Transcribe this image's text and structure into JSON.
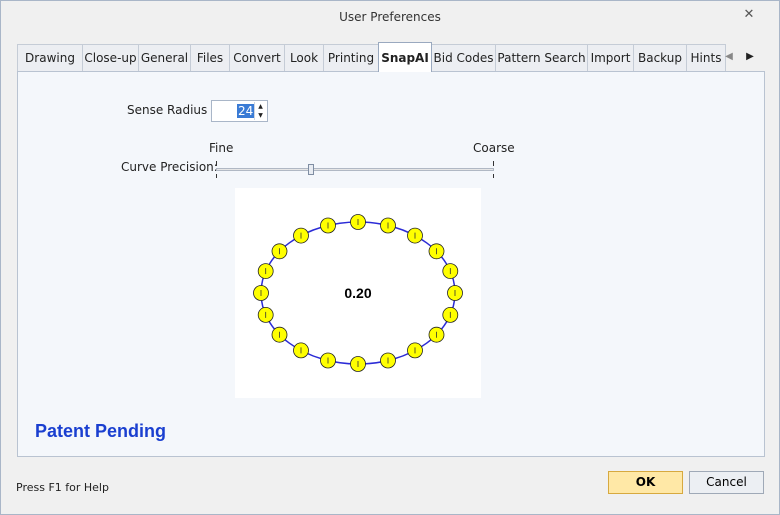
{
  "window": {
    "title": "User Preferences"
  },
  "tabs": [
    {
      "label": "Drawing"
    },
    {
      "label": "Close-up"
    },
    {
      "label": "General"
    },
    {
      "label": "Files"
    },
    {
      "label": "Convert"
    },
    {
      "label": "Look"
    },
    {
      "label": "Printing"
    },
    {
      "label": "SnapAI"
    },
    {
      "label": "Bid Codes"
    },
    {
      "label": "Pattern Search"
    },
    {
      "label": "Import"
    },
    {
      "label": "Backup"
    },
    {
      "label": "Hints"
    }
  ],
  "active_tab": "SnapAI",
  "snapai": {
    "sense_radius_label": "Sense Radius :",
    "sense_radius_value": "24",
    "curve_precision_label": "Curve Precision:",
    "fine_label": "Fine",
    "coarse_label": "Coarse",
    "curve_precision_level": 0.34,
    "preview_value": "0.20",
    "preview_points": 20,
    "patent_text": "Patent Pending"
  },
  "status_text": "Press F1 for Help",
  "buttons": {
    "ok": "OK",
    "cancel": "Cancel"
  },
  "icons": {
    "close": "close-icon",
    "scroll_left": "tab-scroll-left-icon",
    "scroll_right": "tab-scroll-right-icon"
  },
  "colors": {
    "link_blue": "#1a3fd0",
    "ok_fill": "#ffe8a6",
    "dot_fill": "#ffff00",
    "curve_line": "#2b2bd6",
    "selection": "#3a7bd5"
  }
}
